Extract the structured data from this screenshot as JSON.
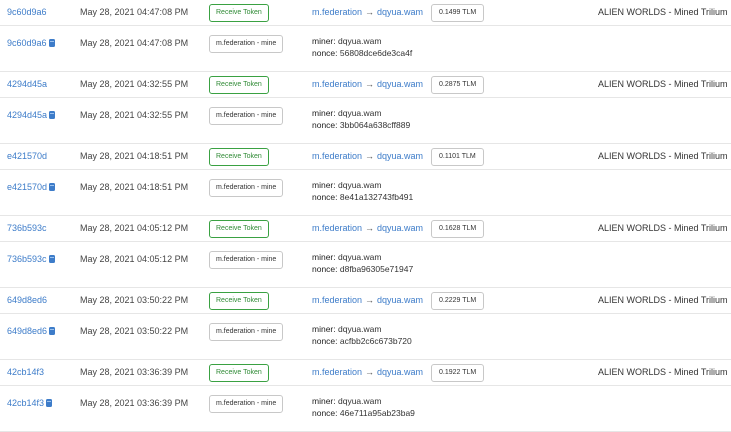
{
  "rows": [
    {
      "kind": "transfer",
      "tx": "9c60d9a6",
      "date": "May 28, 2021 04:47:08 PM",
      "badge": "Receive Token",
      "from": "m.federation",
      "to": "dqyua.wam",
      "amount": "0.1499 TLM",
      "memo": "ALIEN WORLDS - Mined Trilium"
    },
    {
      "kind": "action",
      "tx": "9c60d9a6",
      "date": "May 28, 2021 04:47:08 PM",
      "badge": "m.federation - mine",
      "miner_label": "miner:",
      "miner": "dqyua.wam",
      "nonce_label": "nonce:",
      "nonce": "56808dce6de3ca4f"
    },
    {
      "kind": "transfer",
      "tx": "4294d45a",
      "date": "May 28, 2021 04:32:55 PM",
      "badge": "Receive Token",
      "from": "m.federation",
      "to": "dqyua.wam",
      "amount": "0.2875 TLM",
      "memo": "ALIEN WORLDS - Mined Trilium"
    },
    {
      "kind": "action",
      "tx": "4294d45a",
      "date": "May 28, 2021 04:32:55 PM",
      "badge": "m.federation - mine",
      "miner_label": "miner:",
      "miner": "dqyua.wam",
      "nonce_label": "nonce:",
      "nonce": "3bb064a638cff889"
    },
    {
      "kind": "transfer",
      "tx": "e421570d",
      "date": "May 28, 2021 04:18:51 PM",
      "badge": "Receive Token",
      "from": "m.federation",
      "to": "dqyua.wam",
      "amount": "0.1101 TLM",
      "memo": "ALIEN WORLDS - Mined Trilium"
    },
    {
      "kind": "action",
      "tx": "e421570d",
      "date": "May 28, 2021 04:18:51 PM",
      "badge": "m.federation - mine",
      "miner_label": "miner:",
      "miner": "dqyua.wam",
      "nonce_label": "nonce:",
      "nonce": "8e41a132743fb491"
    },
    {
      "kind": "transfer",
      "tx": "736b593c",
      "date": "May 28, 2021 04:05:12 PM",
      "badge": "Receive Token",
      "from": "m.federation",
      "to": "dqyua.wam",
      "amount": "0.1628 TLM",
      "memo": "ALIEN WORLDS - Mined Trilium"
    },
    {
      "kind": "action",
      "tx": "736b593c",
      "date": "May 28, 2021 04:05:12 PM",
      "badge": "m.federation - mine",
      "miner_label": "miner:",
      "miner": "dqyua.wam",
      "nonce_label": "nonce:",
      "nonce": "d8fba96305e71947"
    },
    {
      "kind": "transfer",
      "tx": "649d8ed6",
      "date": "May 28, 2021 03:50:22 PM",
      "badge": "Receive Token",
      "from": "m.federation",
      "to": "dqyua.wam",
      "amount": "0.2229 TLM",
      "memo": "ALIEN WORLDS - Mined Trilium"
    },
    {
      "kind": "action",
      "tx": "649d8ed6",
      "date": "May 28, 2021 03:50:22 PM",
      "badge": "m.federation - mine",
      "miner_label": "miner:",
      "miner": "dqyua.wam",
      "nonce_label": "nonce:",
      "nonce": "acfbb2c6c673b720"
    },
    {
      "kind": "transfer",
      "tx": "42cb14f3",
      "date": "May 28, 2021 03:36:39 PM",
      "badge": "Receive Token",
      "from": "m.federation",
      "to": "dqyua.wam",
      "amount": "0.1922 TLM",
      "memo": "ALIEN WORLDS - Mined Trilium"
    },
    {
      "kind": "action",
      "tx": "42cb14f3",
      "date": "May 28, 2021 03:36:39 PM",
      "badge": "m.federation - mine",
      "miner_label": "miner:",
      "miner": "dqyua.wam",
      "nonce_label": "nonce:",
      "nonce": "46e711a95ab23ba9"
    }
  ],
  "icons": {
    "action_row": "contract-cube-icon",
    "flow_arrow": "arrow-right-icon"
  },
  "glyphs": {
    "arrow": "→"
  },
  "colors": {
    "link": "#3d7cc9",
    "receive_badge": "#3aa142",
    "divider": "#e6e6e6"
  }
}
